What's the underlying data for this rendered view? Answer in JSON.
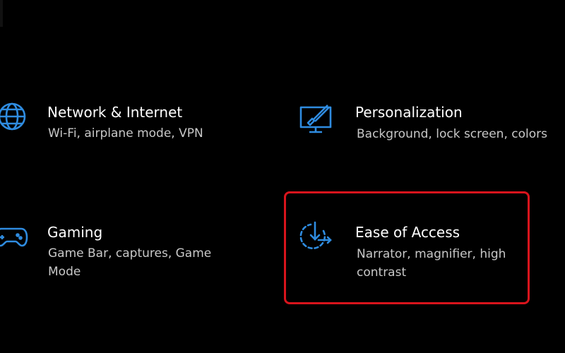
{
  "settings": {
    "tiles": [
      {
        "id": "network",
        "title": "Network & Internet",
        "description": "Wi-Fi, airplane mode, VPN",
        "icon": "globe-icon"
      },
      {
        "id": "personalization",
        "title": "Personalization",
        "description": "Background, lock screen, colors",
        "icon": "paint-monitor-icon"
      },
      {
        "id": "gaming",
        "title": "Gaming",
        "description": "Game Bar, captures, Game Mode",
        "icon": "gamepad-icon"
      },
      {
        "id": "ease-of-access",
        "title": "Ease of Access",
        "description": "Narrator, magnifier, high contrast",
        "icon": "ease-of-access-icon",
        "highlighted": true
      }
    ]
  },
  "colors": {
    "background": "#000000",
    "icon_accent": "#2f8ce0",
    "title_text": "#ffffff",
    "description_text": "#c8c8c8",
    "highlight_border": "#d8141c"
  }
}
